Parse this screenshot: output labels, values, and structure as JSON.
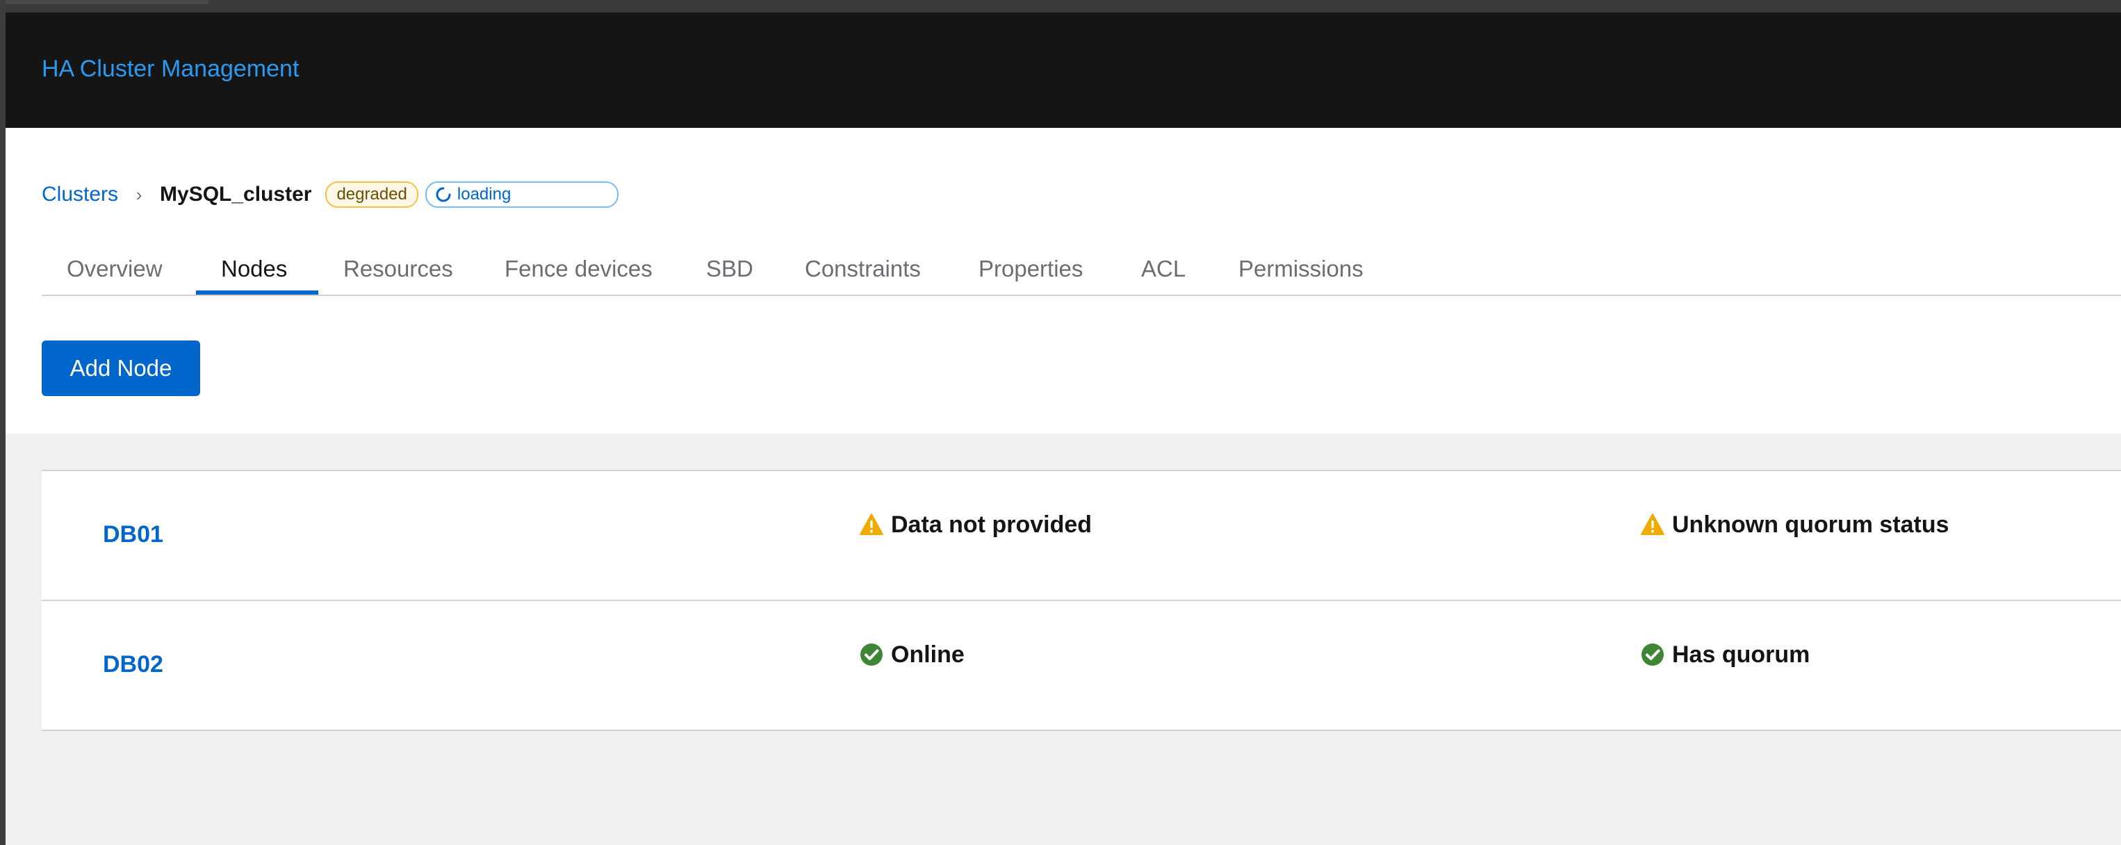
{
  "app": {
    "title": "HA Cluster Management"
  },
  "breadcrumb": {
    "clusters_label": "Clusters",
    "separator": "›",
    "cluster_name": "MySQL_cluster",
    "status_label": "degraded",
    "loading_label": "loading"
  },
  "tabs": [
    {
      "label": "Overview",
      "active": false
    },
    {
      "label": "Nodes",
      "active": true
    },
    {
      "label": "Resources",
      "active": false
    },
    {
      "label": "Fence devices",
      "active": false
    },
    {
      "label": "SBD",
      "active": false
    },
    {
      "label": "Constraints",
      "active": false
    },
    {
      "label": "Properties",
      "active": false
    },
    {
      "label": "ACL",
      "active": false
    },
    {
      "label": "Permissions",
      "active": false
    }
  ],
  "toolbar": {
    "add_node_label": "Add Node"
  },
  "nodes": [
    {
      "name": "DB01",
      "node_status": "Data not provided",
      "node_status_icon": "warning-triangle-icon",
      "quorum_status": "Unknown quorum status",
      "quorum_status_icon": "warning-triangle-icon"
    },
    {
      "name": "DB02",
      "node_status": "Online",
      "node_status_icon": "check-circle-icon",
      "quorum_status": "Has quorum",
      "quorum_status_icon": "check-circle-icon"
    }
  ],
  "colors": {
    "masthead_bg": "#151515",
    "brand": "#2b9af3",
    "link": "#0066cc",
    "primary_button": "#0066cc",
    "warning": "#f0ab00",
    "success": "#3e8635",
    "page_bg": "#f0f0f0",
    "degraded_border": "#f4c145"
  }
}
